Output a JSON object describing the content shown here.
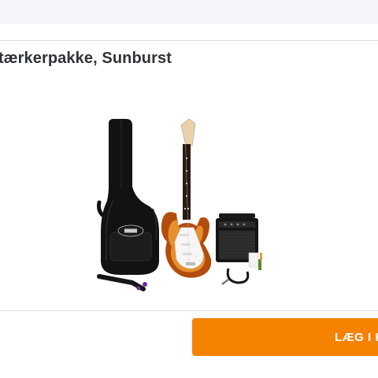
{
  "product": {
    "title": "tærkerpakke, Sunburst",
    "image_alt": "Elektrisk guitar startpakke med taske, forstærker, kabel og strop"
  },
  "actions": {
    "add_to_cart_label": "LÆG I K"
  },
  "colors": {
    "accent": "#f58200",
    "title_text": "#2e3338",
    "top_bar": "#f6f6fa"
  }
}
